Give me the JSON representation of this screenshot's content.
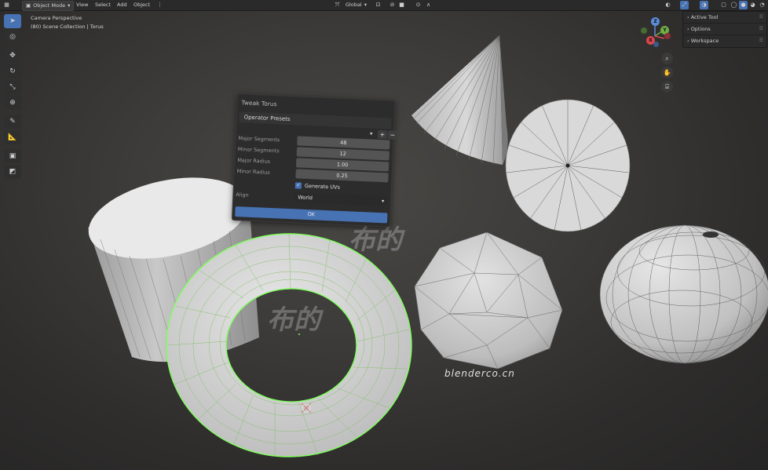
{
  "header": {
    "mode_label": "Object Mode",
    "menu": [
      "View",
      "Select",
      "Add",
      "Object"
    ],
    "transform_orientation": "Global"
  },
  "viewport": {
    "view_name": "Camera Perspective",
    "collection_info": "(80) Scene Collection | Torus"
  },
  "gizmo": {
    "z": "Z",
    "y": "Y",
    "x": "X"
  },
  "sidebar": {
    "items": [
      {
        "label": "Active Tool"
      },
      {
        "label": "Options"
      },
      {
        "label": "Workspace"
      }
    ]
  },
  "redo_panel": {
    "title": "Tweak Torus",
    "presets_label": "Operator Presets",
    "fields": [
      {
        "label": "Major Segments",
        "value": "48"
      },
      {
        "label": "Minor Segments",
        "value": "12"
      },
      {
        "label": "Major Radius",
        "value": "1.00"
      },
      {
        "label": "Minor Radius",
        "value": "0.25"
      }
    ],
    "generate_uvs_label": "Generate UVs",
    "generate_uvs": true,
    "align_label": "Align",
    "align_value": "World",
    "ok_label": "OK"
  },
  "watermarks": {
    "site": "blenderco.cn",
    "cn": "布的"
  },
  "colors": {
    "accent": "#4772b3",
    "selection": "#7dff5a",
    "mesh": "#c9c9c9"
  }
}
